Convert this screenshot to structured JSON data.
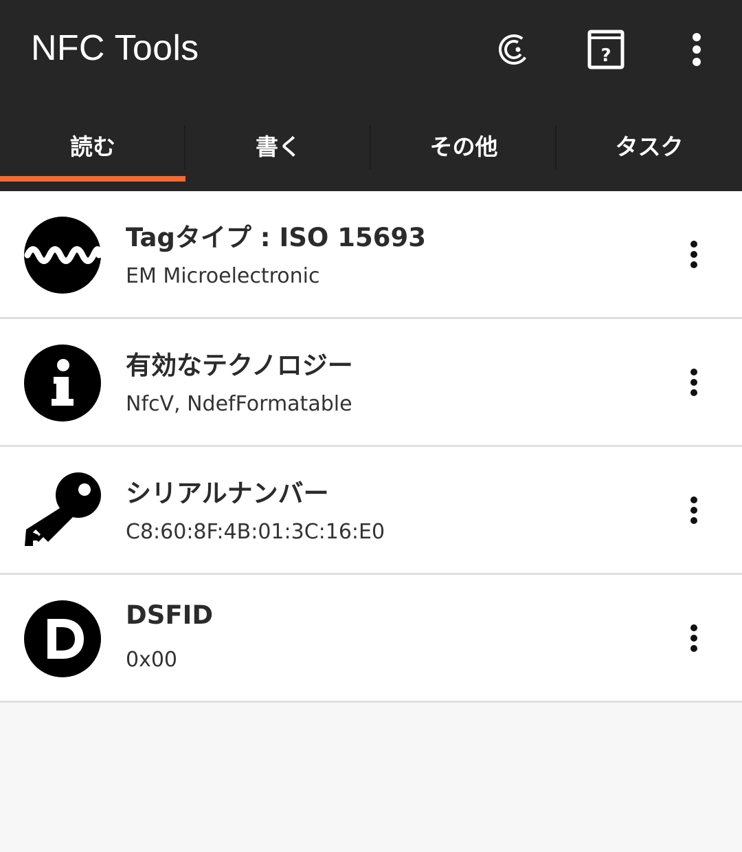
{
  "app": {
    "title": "NFC Tools",
    "accent_color": "#f26a36",
    "bar_color": "#262626"
  },
  "toolbar": {
    "actions": [
      {
        "icon": "pro-coin-icon"
      },
      {
        "icon": "help-book-icon"
      },
      {
        "icon": "more-vert-icon"
      }
    ]
  },
  "tabs": [
    {
      "label": "読む",
      "selected": true
    },
    {
      "label": "書く",
      "selected": false
    },
    {
      "label": "その他",
      "selected": false
    },
    {
      "label": "タスク",
      "selected": false
    }
  ],
  "records": [
    {
      "icon": "waveform-icon",
      "title": "Tagタイプ : ISO 15693",
      "value": "EM Microelectronic"
    },
    {
      "icon": "info-icon",
      "title": "有効なテクノロジー",
      "value": "NfcV, NdefFormatable"
    },
    {
      "icon": "key-icon",
      "title": "シリアルナンバー",
      "value": "C8:60:8F:4B:01:3C:16:E0"
    },
    {
      "icon": "letter-d-icon",
      "title": "DSFID",
      "value": "0x00"
    }
  ]
}
